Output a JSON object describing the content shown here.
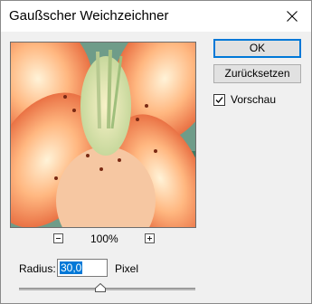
{
  "window": {
    "title": "Gaußscher Weichzeichner",
    "close_icon": "close-icon"
  },
  "buttons": {
    "ok_label": "OK",
    "reset_label": "Zurücksetzen"
  },
  "preview_option": {
    "label": "Vorschau",
    "checked": true
  },
  "zoom": {
    "level": "100%",
    "zoom_out_icon": "minus-icon",
    "zoom_in_icon": "plus-icon"
  },
  "radius": {
    "label": "Radius:",
    "value": "30,0",
    "unit": "Pixel",
    "slider_fraction": 0.48
  },
  "colors": {
    "accent": "#0078d7",
    "dialog_bg": "#f0f0f0"
  }
}
